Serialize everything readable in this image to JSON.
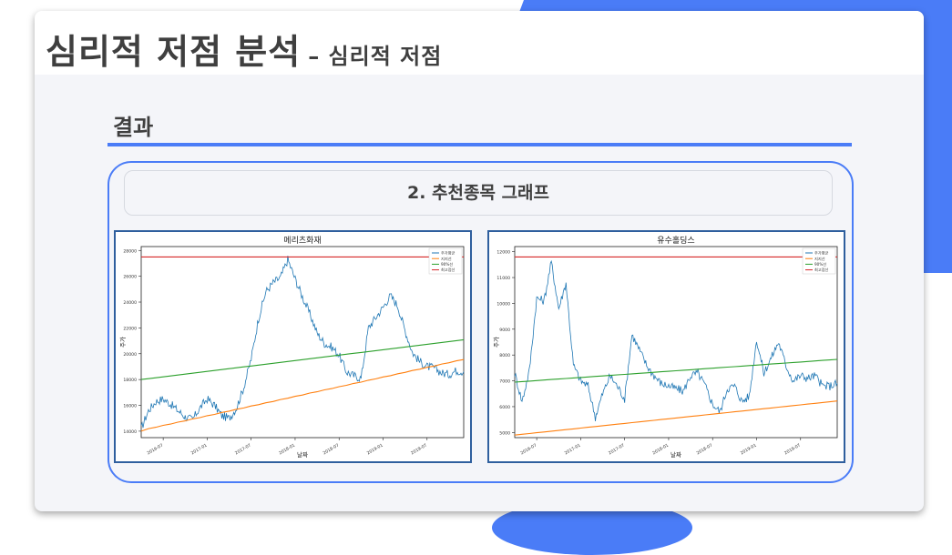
{
  "slide": {
    "title": "심리적 저점 분석",
    "subtitle": "– 심리적 저점",
    "section_heading": "결과",
    "caption": "2. 추천종목 그래프"
  },
  "colors": {
    "accent": "#4a7cf7",
    "price": "#1f77b4",
    "support": "#ff7f0e",
    "band": "#2ca02c",
    "high": "#d62728"
  },
  "chart_data": [
    {
      "type": "line",
      "title": "메리츠화재",
      "xlabel": "날짜",
      "ylabel": "주가",
      "ylim": [
        13500,
        28300
      ],
      "yticks": [
        14000,
        16000,
        18000,
        20000,
        22000,
        24000,
        26000,
        28000
      ],
      "xticks": [
        "2016-07",
        "2017-01",
        "2017-07",
        "2018-01",
        "2018-07",
        "2019-01",
        "2019-07"
      ],
      "grid": false,
      "legend_position": "top-right",
      "x": [
        "2016-04",
        "2016-05",
        "2016-06",
        "2016-07",
        "2016-08",
        "2016-09",
        "2016-10",
        "2016-11",
        "2016-12",
        "2017-01",
        "2017-02",
        "2017-03",
        "2017-04",
        "2017-05",
        "2017-06",
        "2017-07",
        "2017-08",
        "2017-09",
        "2017-10",
        "2017-11",
        "2017-12",
        "2018-01",
        "2018-02",
        "2018-03",
        "2018-04",
        "2018-05",
        "2018-06",
        "2018-07",
        "2018-08",
        "2018-09",
        "2018-10",
        "2018-11",
        "2018-12",
        "2019-01",
        "2019-02",
        "2019-03",
        "2019-04",
        "2019-05",
        "2019-06",
        "2019-07",
        "2019-08",
        "2019-09",
        "2019-10",
        "2019-11",
        "2019-12"
      ],
      "series": [
        {
          "name": "주가평균",
          "values": [
            14200,
            15600,
            16300,
            16500,
            16100,
            15600,
            15100,
            14900,
            15800,
            16500,
            16000,
            15200,
            15000,
            15800,
            17400,
            19600,
            22700,
            24800,
            25500,
            25900,
            27300,
            25800,
            24400,
            23100,
            21600,
            20800,
            20500,
            19900,
            18600,
            18300,
            18100,
            22000,
            22800,
            23600,
            24500,
            23700,
            21800,
            20100,
            19400,
            19000,
            18900,
            18500,
            18400,
            18700,
            18600
          ]
        },
        {
          "name": "지지선",
          "values": [
            14000,
            14200,
            14300,
            14450,
            14550,
            14700,
            14800,
            14950,
            15050,
            15200,
            15300,
            15450,
            15550,
            15700,
            15800,
            15950,
            16050,
            16200,
            16300,
            16450,
            16550,
            16700,
            16800,
            16950,
            17050,
            17200,
            17300,
            17450,
            17550,
            17700,
            17800,
            17950,
            18050,
            18200,
            18300,
            18450,
            18550,
            18700,
            18800,
            18950,
            19050,
            19200,
            19300,
            19450,
            19550
          ]
        },
        {
          "name": "90%선",
          "values": [
            18000,
            18070,
            18140,
            18210,
            18280,
            18350,
            18420,
            18490,
            18560,
            18630,
            18700,
            18770,
            18840,
            18910,
            18980,
            19050,
            19120,
            19190,
            19260,
            19330,
            19400,
            19470,
            19540,
            19610,
            19680,
            19750,
            19820,
            19890,
            19960,
            20030,
            20100,
            20170,
            20240,
            20310,
            20380,
            20450,
            20520,
            20590,
            20660,
            20730,
            20800,
            20870,
            20940,
            21010,
            21080
          ]
        },
        {
          "name": "최고점선",
          "values": [
            27500,
            27500,
            27500,
            27500,
            27500,
            27500,
            27500,
            27500,
            27500,
            27500,
            27500,
            27500,
            27500,
            27500,
            27500,
            27500,
            27500,
            27500,
            27500,
            27500,
            27500,
            27500,
            27500,
            27500,
            27500,
            27500,
            27500,
            27500,
            27500,
            27500,
            27500,
            27500,
            27500,
            27500,
            27500,
            27500,
            27500,
            27500,
            27500,
            27500,
            27500,
            27500,
            27500,
            27500,
            27500
          ]
        }
      ]
    },
    {
      "type": "line",
      "title": "유수홀딩스",
      "xlabel": "날짜",
      "ylabel": "주가",
      "ylim": [
        4800,
        12200
      ],
      "yticks": [
        5000,
        6000,
        7000,
        8000,
        9000,
        10000,
        11000,
        12000
      ],
      "xticks": [
        "2016-07",
        "2017-01",
        "2017-07",
        "2018-01",
        "2018-07",
        "2019-01",
        "2019-07"
      ],
      "grid": false,
      "legend_position": "top-right",
      "x": [
        "2016-04",
        "2016-05",
        "2016-06",
        "2016-07",
        "2016-08",
        "2016-09",
        "2016-10",
        "2016-11",
        "2016-12",
        "2017-01",
        "2017-02",
        "2017-03",
        "2017-04",
        "2017-05",
        "2017-06",
        "2017-07",
        "2017-08",
        "2017-09",
        "2017-10",
        "2017-11",
        "2017-12",
        "2018-01",
        "2018-02",
        "2018-03",
        "2018-04",
        "2018-05",
        "2018-06",
        "2018-07",
        "2018-08",
        "2018-09",
        "2018-10",
        "2018-11",
        "2018-12",
        "2019-01",
        "2019-02",
        "2019-03",
        "2019-04",
        "2019-05",
        "2019-06",
        "2019-07",
        "2019-08",
        "2019-09",
        "2019-10",
        "2019-11",
        "2019-12"
      ],
      "series": [
        {
          "name": "주가평균",
          "values": [
            7300,
            6200,
            7400,
            10200,
            10100,
            11600,
            9800,
            10800,
            7600,
            7000,
            6800,
            5600,
            6500,
            7200,
            6800,
            6300,
            8800,
            8200,
            7600,
            7200,
            6900,
            6800,
            6700,
            6600,
            7200,
            7300,
            6800,
            6100,
            5800,
            6700,
            6800,
            6200,
            6400,
            8600,
            7300,
            7900,
            8500,
            7600,
            7000,
            7200,
            7100,
            7200,
            6800,
            6800,
            6900
          ]
        },
        {
          "name": "지지선",
          "values": [
            4900,
            4930,
            4960,
            4990,
            5020,
            5050,
            5080,
            5110,
            5140,
            5170,
            5200,
            5230,
            5260,
            5290,
            5320,
            5350,
            5380,
            5410,
            5440,
            5470,
            5500,
            5530,
            5560,
            5590,
            5620,
            5650,
            5680,
            5710,
            5740,
            5770,
            5800,
            5830,
            5860,
            5890,
            5920,
            5950,
            5980,
            6010,
            6040,
            6070,
            6100,
            6130,
            6160,
            6190,
            6220
          ]
        },
        {
          "name": "90%선",
          "values": [
            6950,
            6970,
            6990,
            7010,
            7030,
            7050,
            7070,
            7090,
            7110,
            7130,
            7150,
            7170,
            7190,
            7210,
            7230,
            7250,
            7270,
            7290,
            7310,
            7330,
            7350,
            7370,
            7390,
            7410,
            7430,
            7450,
            7470,
            7490,
            7510,
            7530,
            7550,
            7570,
            7590,
            7610,
            7630,
            7650,
            7670,
            7690,
            7710,
            7730,
            7750,
            7770,
            7790,
            7810,
            7830
          ]
        },
        {
          "name": "최고점선",
          "values": [
            11800,
            11800,
            11800,
            11800,
            11800,
            11800,
            11800,
            11800,
            11800,
            11800,
            11800,
            11800,
            11800,
            11800,
            11800,
            11800,
            11800,
            11800,
            11800,
            11800,
            11800,
            11800,
            11800,
            11800,
            11800,
            11800,
            11800,
            11800,
            11800,
            11800,
            11800,
            11800,
            11800,
            11800,
            11800,
            11800,
            11800,
            11800,
            11800,
            11800,
            11800,
            11800,
            11800,
            11800,
            11800
          ]
        }
      ]
    }
  ]
}
